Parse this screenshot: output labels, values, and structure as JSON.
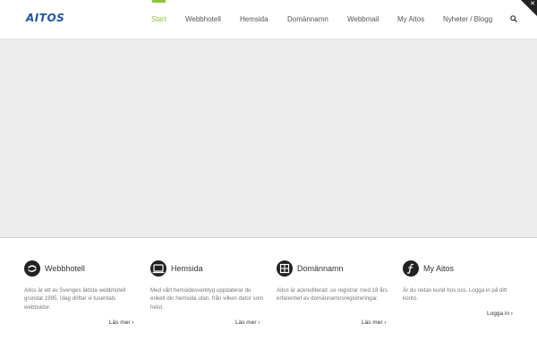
{
  "logo": {
    "text": "AITOS"
  },
  "nav": {
    "items": [
      {
        "label": "Start",
        "active": true
      },
      {
        "label": "Webbhotell",
        "active": false
      },
      {
        "label": "Hemsida",
        "active": false
      },
      {
        "label": "Domännamn",
        "active": false
      },
      {
        "label": "Webbmail",
        "active": false
      },
      {
        "label": "My Aitos",
        "active": false
      },
      {
        "label": "Nyheter / Blogg",
        "active": false
      }
    ],
    "search_icon": "search-icon"
  },
  "colors": {
    "accent": "#8cc63f",
    "logo": "#1f57a8",
    "hero_bg": "#ececec",
    "icon_bg": "#222222"
  },
  "features": [
    {
      "icon": "refresh-circle-icon",
      "title": "Webbhotell",
      "text": "Aitos är ett av Svenges äldsta webbhotell grundat 1995. Idag driftar vi tusentals webbsidor.",
      "link": "Läs mer ›"
    },
    {
      "icon": "monitor-icon",
      "title": "Hemsida",
      "text": "Med vårt hemsidesverktyg uppdaterar du enkelt din hemsida utan, från vilken dator som helst.",
      "link": "Läs mer ›"
    },
    {
      "icon": "server-icon",
      "title": "Domännamn",
      "text": "Aitos är ackrediterad .se registrar med 18 års erfarenhet av domännamnsregistreringar.",
      "link": "Läs mer ›"
    },
    {
      "icon": "function-icon",
      "title": "My Aitos",
      "text": "Är du redan kund hos oss. Logga in på ditt konto.",
      "link": "Logga in ›"
    }
  ]
}
